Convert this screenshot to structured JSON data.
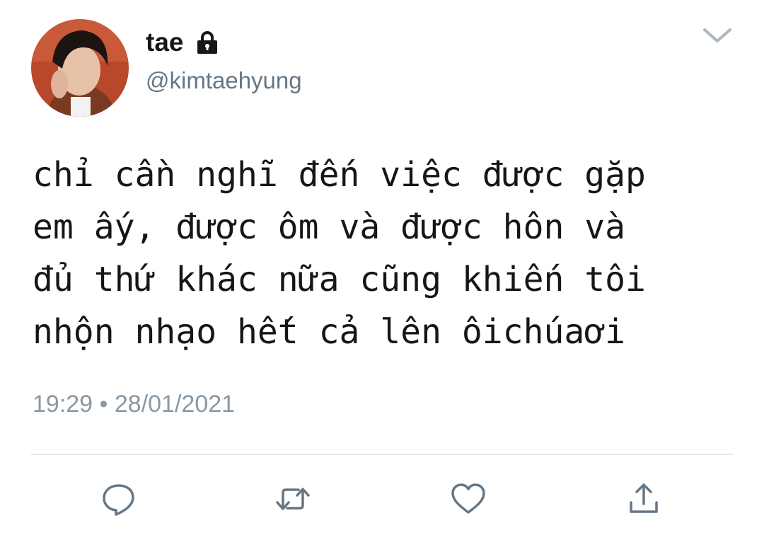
{
  "tweet": {
    "display_name": "tae",
    "handle": "@kimtaehyung",
    "protected_icon": "lock-icon",
    "text_lines": [
      "chỉ cần nghĩ đến việc được gặp",
      "em ấy, được ôm và được hôn và",
      "đủ thứ khác nữa cũng khiến tôi",
      "nhộn nhạo hết cả lên ôichúaơi"
    ],
    "timestamp": "19:29 • 28/01/2021"
  },
  "icons": {
    "menu": "chevron-down-icon",
    "reply": "reply-icon",
    "retweet": "retweet-icon",
    "like": "heart-icon",
    "share": "share-icon"
  },
  "colors": {
    "text": "#14171a",
    "secondary": "#657786",
    "muted": "#8899a6",
    "icon": "#657786",
    "divider": "#e1e8ed"
  }
}
